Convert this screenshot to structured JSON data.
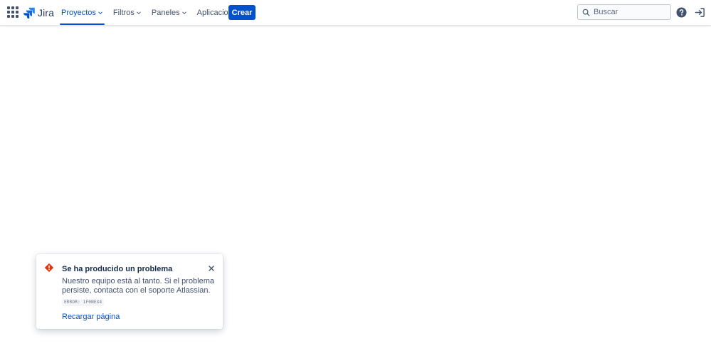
{
  "header": {
    "logo_text": "Jira",
    "nav": [
      {
        "label": "Proyectos",
        "active": true
      },
      {
        "label": "Filtros",
        "active": false
      },
      {
        "label": "Paneles",
        "active": false
      },
      {
        "label": "Aplicaciones",
        "active": false
      }
    ],
    "create_label": "Crear",
    "search": {
      "placeholder": "Buscar",
      "value": ""
    }
  },
  "flag": {
    "title": "Se ha producido un problema",
    "description": "Nuestro equipo está al tanto. Si el problema persiste, contacta con el soporte Atlassian.",
    "error_code": "ERROR: 1F0NEX4",
    "action_label": "Recargar página"
  },
  "colors": {
    "brand": "#0052cc",
    "error": "#de350b",
    "text": "#172b4d",
    "subtle_text": "#42526e"
  },
  "icons": [
    "app-switcher-icon",
    "jira-logo-icon",
    "chevron-down-icon",
    "search-icon",
    "help-icon",
    "log-in-icon",
    "error-icon",
    "close-icon"
  ]
}
